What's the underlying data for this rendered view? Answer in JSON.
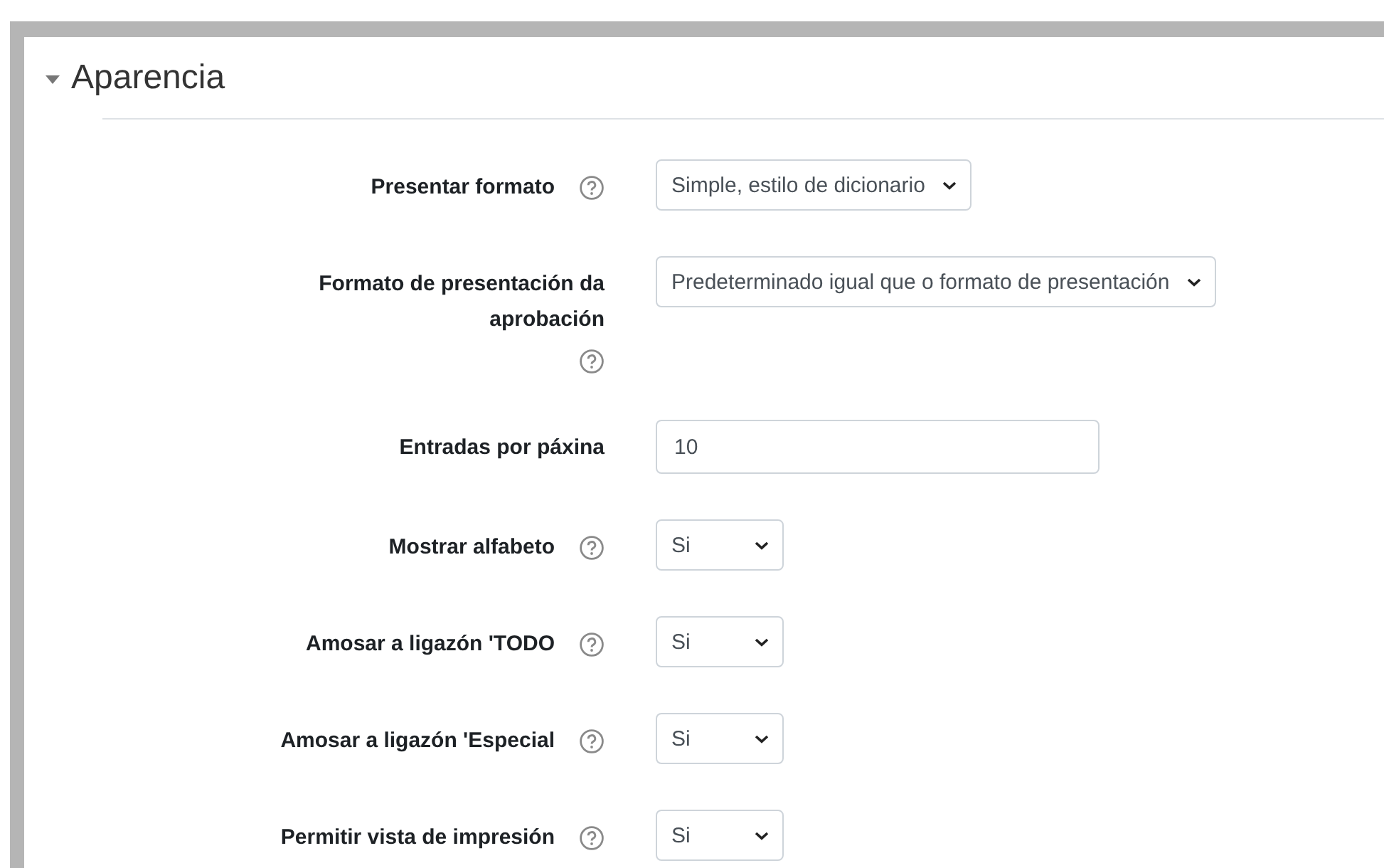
{
  "section": {
    "title": "Aparencia",
    "expanded": true
  },
  "fields": [
    {
      "label": "Presentar formato",
      "help": true,
      "kind": "select",
      "value": "Simple, estilo de dicionario"
    },
    {
      "label": "Formato de presentación da aprobación",
      "help": true,
      "kind": "select",
      "value": "Predeterminado igual que o formato de presentación"
    },
    {
      "label": "Entradas por páxina",
      "help": false,
      "kind": "text",
      "value": "10"
    },
    {
      "label": "Mostrar alfabeto",
      "help": true,
      "kind": "select",
      "value": "Si"
    },
    {
      "label": "Amosar a ligazón 'TODO",
      "help": true,
      "kind": "select",
      "value": "Si"
    },
    {
      "label": "Amosar a ligazón 'Especial",
      "help": true,
      "kind": "select",
      "value": "Si"
    },
    {
      "label": "Permitir vista de impresión",
      "help": true,
      "kind": "select",
      "value": "Si"
    }
  ]
}
